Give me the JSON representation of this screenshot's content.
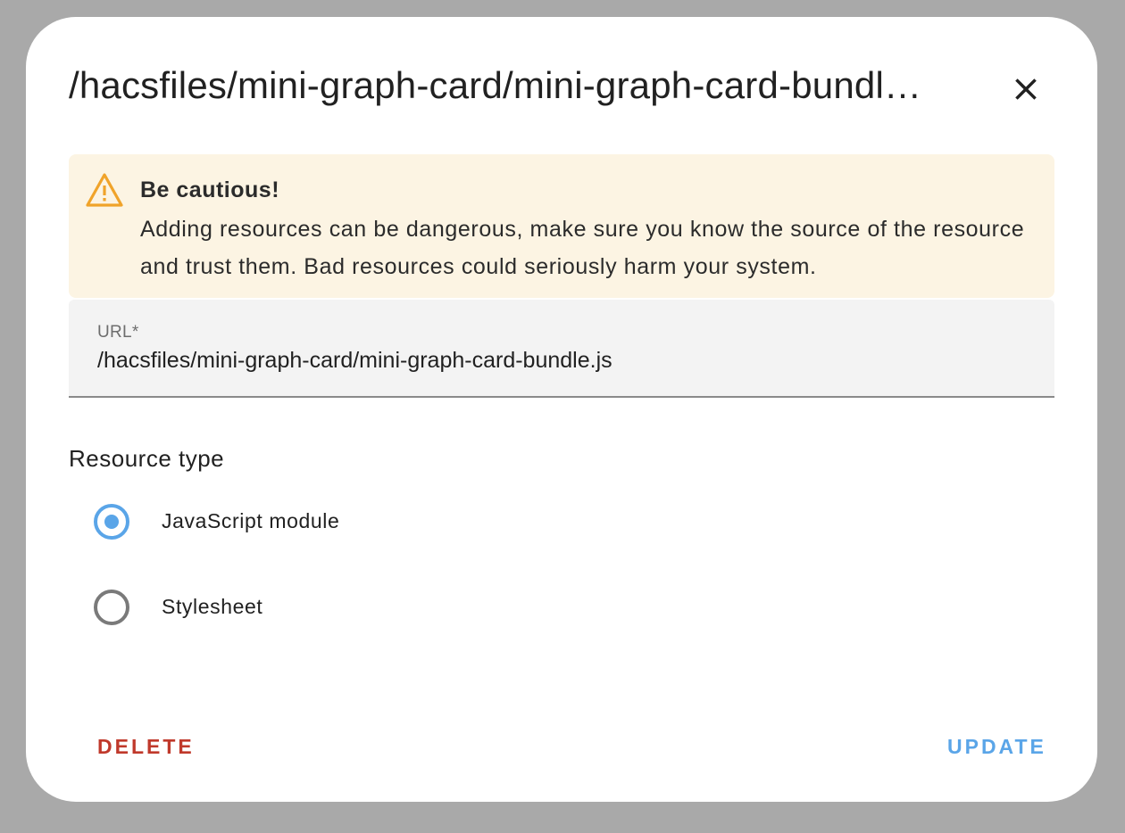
{
  "dialog": {
    "title": "/hacsfiles/mini-graph-card/mini-graph-card-bundl…",
    "close_icon": "close-icon"
  },
  "alert": {
    "icon": "warning-icon",
    "title": "Be cautious!",
    "text": "Adding resources can be dangerous, make sure you know the source of the resource and trust them. Bad resources could seriously harm your system.",
    "icon_color": "#f0a32a"
  },
  "url_field": {
    "label": "URL*",
    "value": "/hacsfiles/mini-graph-card/mini-graph-card-bundle.js"
  },
  "resource_type": {
    "label": "Resource type",
    "options": [
      {
        "label": "JavaScript module",
        "checked": true
      },
      {
        "label": "Stylesheet",
        "checked": false
      }
    ]
  },
  "actions": {
    "delete_label": "DELETE",
    "update_label": "UPDATE",
    "delete_color": "#c0392b",
    "update_color": "#5aa5e8"
  }
}
